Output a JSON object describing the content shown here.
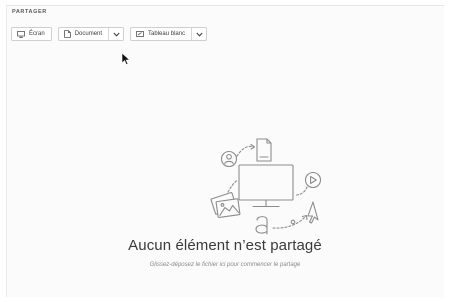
{
  "section": {
    "title": "PARTAGER"
  },
  "toolbar": {
    "screen_label": "Écran",
    "document_label": "Document",
    "whiteboard_label": "Tableau blanc"
  },
  "empty_state": {
    "title": "Aucun élément n’est partagé",
    "subtitle": "Glissez-déposez le fichier ici pour commencer le partage"
  },
  "colors": {
    "panel_background": "#fbfbfb",
    "border": "#cfcfcf",
    "icon_stroke": "#8c8c8c",
    "title_text": "#3a3a3a",
    "subtitle_text": "#8a8a8a"
  }
}
